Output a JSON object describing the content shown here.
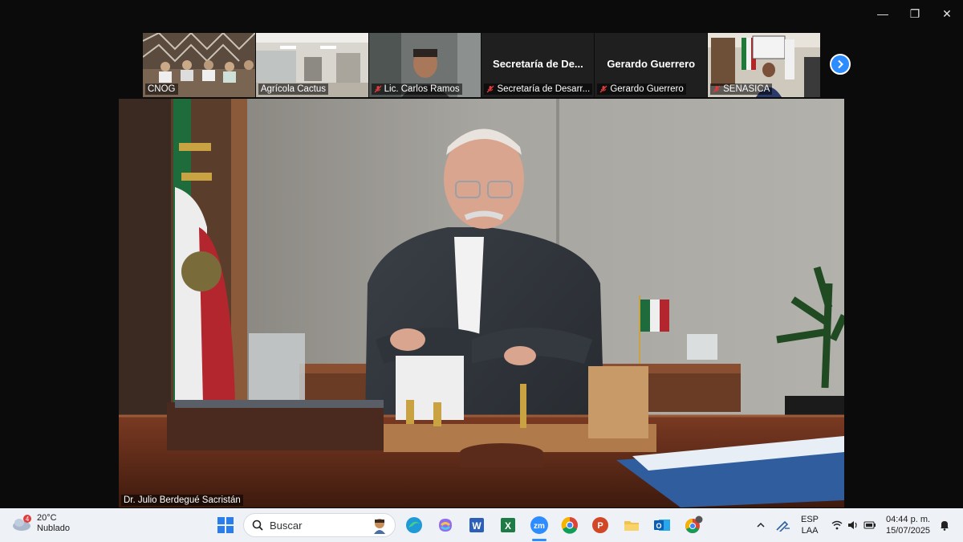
{
  "window_controls": {
    "minimize": "—",
    "restore": "❐",
    "close": "✕"
  },
  "participants": [
    {
      "name": "CNOG",
      "muted": false
    },
    {
      "name": "Agrícola Cactus",
      "muted": false
    },
    {
      "name": "Lic. Carlos Ramos",
      "muted": true
    },
    {
      "name": "Secretaría de Desarr...",
      "display_name": "Secretaría de De...",
      "muted": true
    },
    {
      "name": "Gerardo Guerrero",
      "display_name": "Gerardo Guerrero",
      "muted": true
    },
    {
      "name": "SENASICA",
      "muted": true
    }
  ],
  "active_speaker": {
    "name": "Dr. Julio Berdegué Sacristán"
  },
  "taskbar": {
    "weather": {
      "temp": "20°C",
      "condition": "Nublado",
      "badge": "4"
    },
    "search_placeholder": "Buscar",
    "apps": [
      "start-icon",
      "edge-icon",
      "copilot-icon",
      "word-icon",
      "excel-icon",
      "zoom-icon",
      "chrome-icon",
      "powerpoint-icon",
      "file-explorer-icon",
      "outlook-icon",
      "chrome-profile-icon"
    ],
    "app_labels": {
      "word": "W",
      "excel": "X",
      "zoom": "zm",
      "powerpoint": "P",
      "outlook": "O"
    },
    "language": {
      "code": "ESP",
      "layout": "LAA"
    },
    "clock": {
      "time": "04:44 p. m.",
      "date": "15/07/2025"
    }
  },
  "colors": {
    "zoom_blue": "#2d8cff",
    "taskbar_bg": "#eef1f6"
  }
}
